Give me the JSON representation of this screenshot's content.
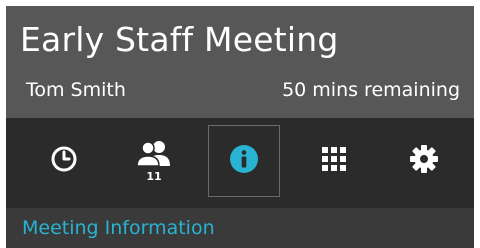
{
  "meeting": {
    "title": "Early Staff Meeting",
    "organizer": "Tom Smith",
    "remaining": "50 mins remaining"
  },
  "toolbar": {
    "items": [
      {
        "icon": "clock-icon"
      },
      {
        "icon": "people-icon",
        "count": "11"
      },
      {
        "icon": "info-icon",
        "selected": true
      },
      {
        "icon": "grid-icon"
      },
      {
        "icon": "gear-icon"
      }
    ]
  },
  "section": {
    "title": "Meeting Information"
  },
  "colors": {
    "accent": "#27b3d1",
    "header": "#575757",
    "toolbar": "#2b2b2b"
  }
}
